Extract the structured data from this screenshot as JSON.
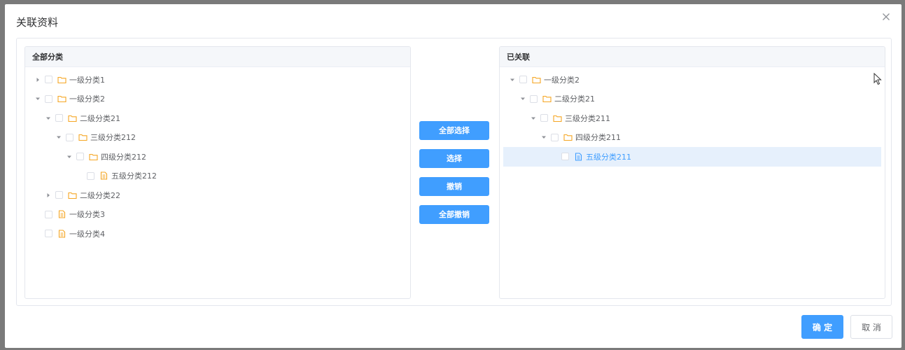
{
  "dialog": {
    "title": "关联资料",
    "ok_label": "确 定",
    "cancel_label": "取 消"
  },
  "left_panel": {
    "header": "全部分类",
    "nodes": [
      {
        "label": "一级分类1",
        "depth": 0,
        "arrow": "right",
        "icon": "folder"
      },
      {
        "label": "一级分类2",
        "depth": 0,
        "arrow": "down",
        "icon": "folder"
      },
      {
        "label": "二级分类21",
        "depth": 1,
        "arrow": "down",
        "icon": "folder"
      },
      {
        "label": "三级分类212",
        "depth": 2,
        "arrow": "down",
        "icon": "folder"
      },
      {
        "label": "四级分类212",
        "depth": 3,
        "arrow": "down",
        "icon": "folder"
      },
      {
        "label": "五级分类212",
        "depth": 4,
        "arrow": "none",
        "icon": "document"
      },
      {
        "label": "二级分类22",
        "depth": 1,
        "arrow": "right",
        "icon": "folder"
      },
      {
        "label": "一级分类3",
        "depth": 0,
        "arrow": "none",
        "icon": "document"
      },
      {
        "label": "一级分类4",
        "depth": 0,
        "arrow": "none",
        "icon": "document"
      }
    ]
  },
  "right_panel": {
    "header": "已关联",
    "nodes": [
      {
        "label": "一级分类2",
        "depth": 0,
        "arrow": "down",
        "icon": "folder"
      },
      {
        "label": "二级分类21",
        "depth": 1,
        "arrow": "down",
        "icon": "folder"
      },
      {
        "label": "三级分类211",
        "depth": 2,
        "arrow": "down",
        "icon": "folder"
      },
      {
        "label": "四级分类211",
        "depth": 3,
        "arrow": "down",
        "icon": "folder"
      },
      {
        "label": "五级分类211",
        "depth": 4,
        "arrow": "none",
        "icon": "document",
        "selected": true
      }
    ]
  },
  "transfer_buttons": {
    "select_all": "全部选择",
    "select": "选择",
    "revoke": "撤销",
    "revoke_all": "全部撤销"
  },
  "colors": {
    "primary": "#409eff",
    "folder": "#f5a623",
    "document": "#f5a623",
    "selected_bg": "#e6f0fc"
  },
  "icons": {
    "close": "close-icon",
    "expand_right": "caret-right-icon",
    "expand_down": "caret-down-icon",
    "folder": "folder-icon",
    "document": "document-icon"
  }
}
